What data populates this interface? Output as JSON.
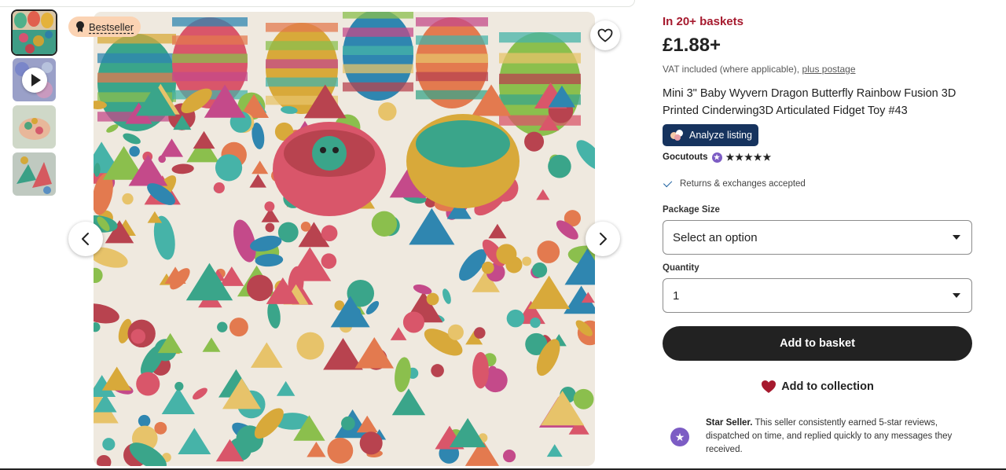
{
  "gallery": {
    "badge_label": "Bestseller",
    "thumbnails": [
      {
        "icon": "eggs-thumbnail",
        "active": true
      },
      {
        "icon": "video-thumbnail",
        "has_play": true
      },
      {
        "icon": "hand-thumbnail"
      },
      {
        "icon": "dragons-thumbnail"
      }
    ],
    "icons": {
      "favorite": "heart-outline-icon",
      "prev": "chevron-left-icon",
      "next": "chevron-right-icon"
    }
  },
  "listing": {
    "baskets_text": "In 20+ baskets",
    "price": "£1.88+",
    "vat_text": "VAT included (where applicable),",
    "postage_link": "plus postage",
    "title": "Mini 3\" Baby Wyvern Dragon Butterfly Rainbow Fusion 3D Printed Cinderwing3D Articulated Fidget Toy #43",
    "analyze_label": "Analyze listing",
    "seller_name": "Gocutouts",
    "rating_stars": "★★★★★",
    "returns_text": "Returns & exchanges accepted",
    "package_label": "Package Size",
    "package_value": "Select an option",
    "quantity_label": "Quantity",
    "quantity_value": "1",
    "add_basket_label": "Add to basket",
    "add_collection_label": "Add to collection",
    "star_seller_title": "Star Seller.",
    "star_seller_text": "This seller consistently earned 5-star reviews, dispatched on time, and replied quickly to any messages they received."
  },
  "colors": {
    "accent_red": "#a61a2e",
    "badge_bg": "#fbd3b3",
    "analyze_bg": "#16335e",
    "star_seller_purple": "#7c5cc4",
    "button_dark": "#222222"
  }
}
